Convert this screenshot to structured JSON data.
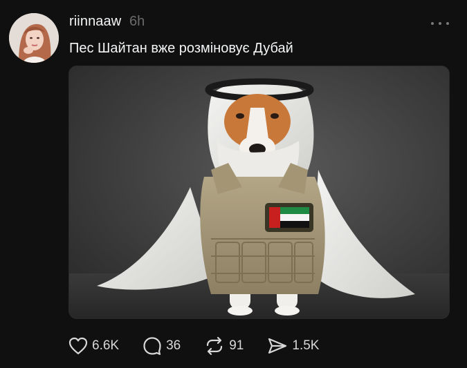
{
  "post": {
    "username": "riinnaaw",
    "timestamp": "6h",
    "caption": "Пес Шайтан вже розміновує Дубай",
    "image_icon": "dog-in-keffiyeh-photo",
    "actions": {
      "like_count": "6.6K",
      "reply_count": "36",
      "repost_count": "91",
      "share_count": "1.5K"
    }
  },
  "colors": {
    "background": "#101010",
    "text_primary": "#f3f5f7",
    "text_secondary": "#6b6b6b"
  }
}
